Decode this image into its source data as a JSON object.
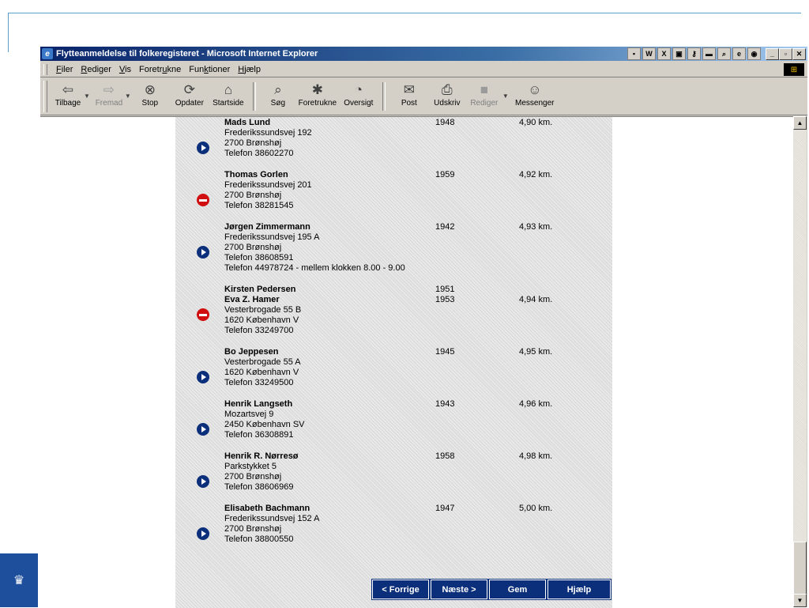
{
  "window": {
    "title": "Flytteanmeldelse til folkeregisteret - Microsoft Internet Explorer"
  },
  "menu": [
    {
      "pre": "",
      "key": "F",
      "post": "iler"
    },
    {
      "pre": "",
      "key": "R",
      "post": "ediger"
    },
    {
      "pre": "",
      "key": "V",
      "post": "is"
    },
    {
      "pre": "Foretr",
      "key": "u",
      "post": "kne"
    },
    {
      "pre": "Fun",
      "key": "k",
      "post": "tioner"
    },
    {
      "pre": "",
      "key": "H",
      "post": "jælp"
    }
  ],
  "toolbar": {
    "back": "Tilbage",
    "forward": "Fremad",
    "stop": "Stop",
    "refresh": "Opdater",
    "home": "Startside",
    "search": "Søg",
    "favorites": "Foretrukne",
    "history": "Oversigt",
    "mail": "Post",
    "print": "Udskriv",
    "edit": "Rediger",
    "messenger": "Messenger"
  },
  "entries": [
    {
      "icon": "go",
      "names": [
        "Mads Lund"
      ],
      "years": [
        "1948"
      ],
      "address": [
        "Frederikssundsvej 192",
        "2700 Brønshøj",
        "Telefon 38602270"
      ],
      "distance": "4,90 km."
    },
    {
      "icon": "stop",
      "names": [
        "Thomas Gorlen"
      ],
      "years": [
        "1959"
      ],
      "address": [
        "Frederikssundsvej 201",
        "2700 Brønshøj",
        "Telefon 38281545"
      ],
      "distance": "4,92 km."
    },
    {
      "icon": "go",
      "names": [
        "Jørgen Zimmermann"
      ],
      "years": [
        "1942"
      ],
      "address": [
        "Frederikssundsvej 195 A",
        "2700 Brønshøj",
        "Telefon 38608591",
        "Telefon 44978724 - mellem klokken 8.00 - 9.00"
      ],
      "distance": "4,93 km."
    },
    {
      "icon": "stop",
      "names": [
        "Kirsten Pedersen",
        "Eva Z. Hamer"
      ],
      "years": [
        "1951",
        "1953"
      ],
      "address": [
        "Vesterbrogade 55 B",
        "1620 København V",
        "Telefon 33249700"
      ],
      "distance": "4,94 km."
    },
    {
      "icon": "go",
      "names": [
        "Bo Jeppesen"
      ],
      "years": [
        "1945"
      ],
      "address": [
        "Vesterbrogade 55 A",
        "1620 København V",
        "Telefon 33249500"
      ],
      "distance": "4,95 km."
    },
    {
      "icon": "go",
      "names": [
        "Henrik Langseth"
      ],
      "years": [
        "1943"
      ],
      "address": [
        "Mozartsvej 9",
        "2450 København SV",
        "Telefon 36308891"
      ],
      "distance": "4,96 km."
    },
    {
      "icon": "go",
      "names": [
        "Henrik R. Nørresø"
      ],
      "years": [
        "1958"
      ],
      "address": [
        "Parkstykket 5",
        "2700 Brønshøj",
        "Telefon 38606969"
      ],
      "distance": "4,98 km."
    },
    {
      "icon": "go",
      "names": [
        "Elisabeth Bachmann"
      ],
      "years": [
        "1947"
      ],
      "address": [
        "Frederikssundsvej 152 A",
        "2700 Brønshøj",
        "Telefon 38800550"
      ],
      "distance": "5,00 km."
    }
  ],
  "buttons": {
    "previous": "< Forrige",
    "next": "Næste >",
    "save": "Gem",
    "help": "Hjælp"
  },
  "colors": {
    "button_blue": "#0b2f7a",
    "stop_red": "#d01010"
  }
}
